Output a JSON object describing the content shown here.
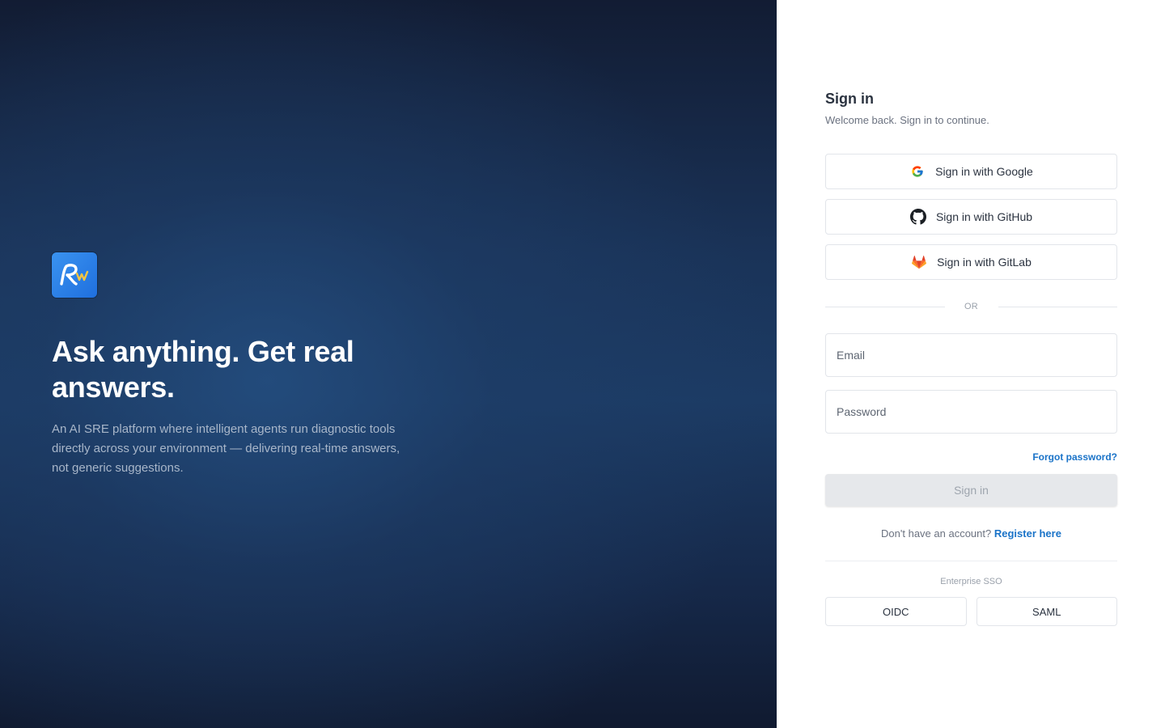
{
  "hero": {
    "logo_icon": "rw-logo-icon",
    "title": "Ask anything. Get real answers.",
    "description": "An AI SRE platform where intelligent agents run diagnostic tools directly across your environment — delivering real-time answers, not generic suggestions."
  },
  "signin": {
    "title": "Sign in",
    "subtitle": "Welcome back. Sign in to continue.",
    "oauth": [
      {
        "label": "Sign in with Google",
        "icon": "google-icon"
      },
      {
        "label": "Sign in with GitHub",
        "icon": "github-icon"
      },
      {
        "label": "Sign in with GitLab",
        "icon": "gitlab-icon"
      }
    ],
    "or_label": "OR",
    "email_placeholder": "Email",
    "password_placeholder": "Password",
    "forgot_label": "Forgot password?",
    "submit_label": "Sign in",
    "register_prompt": "Don't have an account?",
    "register_link": "Register here",
    "sso_label": "Enterprise SSO",
    "sso_buttons": [
      "OIDC",
      "SAML"
    ]
  },
  "colors": {
    "accent": "#1a73c8",
    "hero_bg": "#1c3b64",
    "logo_bg": "#2a83ea"
  }
}
